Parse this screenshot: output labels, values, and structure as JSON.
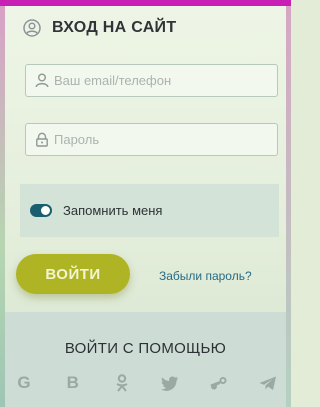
{
  "form": {
    "title": "ВХОД НА САЙТ",
    "email_placeholder": "Ваш email/телефон",
    "password_placeholder": "Пароль",
    "remember_label": "Запомнить меня",
    "remember_checked": true,
    "login_button": "ВОЙТИ",
    "forgot_link": "Забыли пароль?"
  },
  "social": {
    "title": "ВОЙТИ С ПОМОЩЬЮ",
    "icons": [
      "google-icon",
      "vk-icon",
      "odnoklassniki-icon",
      "twitter-icon",
      "steam-icon",
      "telegram-icon"
    ],
    "google_glyph": "G",
    "vk_glyph": "B"
  },
  "colors": {
    "accent_button": "#aeb424",
    "toggle_on": "#1b5e70",
    "link": "#276c86",
    "top_band": "#c81fb4"
  }
}
